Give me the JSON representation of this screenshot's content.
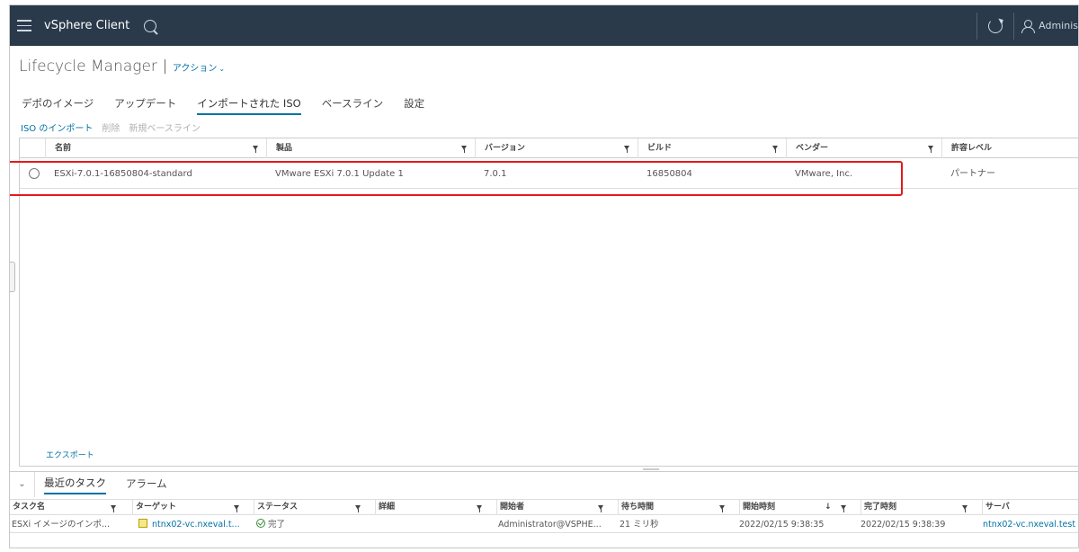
{
  "header": {
    "app_title": "vSphere Client",
    "user": "Adminis"
  },
  "page": {
    "title": "Lifecycle Manager",
    "actions_label": "アクション",
    "actions_chevron": "⌄"
  },
  "tabs": [
    {
      "label": "デポのイメージ"
    },
    {
      "label": "アップデート"
    },
    {
      "label": "インポートされた ISO",
      "active": true
    },
    {
      "label": "ベースライン"
    },
    {
      "label": "設定"
    }
  ],
  "toolbar": {
    "import_iso": "ISO のインポート",
    "delete": "削除",
    "new_baseline": "新規ベースライン"
  },
  "grid": {
    "columns": [
      "名前",
      "製品",
      "バージョン",
      "ビルド",
      "ベンダー",
      "許容レベル"
    ],
    "rows": [
      {
        "name": "ESXi-7.0.1-16850804-standard",
        "product": "VMware ESXi 7.0.1 Update 1",
        "version": "7.0.1",
        "build": "16850804",
        "vendor": "VMware, Inc.",
        "acceptance": "パートナー"
      }
    ],
    "export_label": "エクスポート"
  },
  "bottom": {
    "collapse": "⌄",
    "tabs": [
      {
        "label": "最近のタスク",
        "active": true
      },
      {
        "label": "アラーム"
      }
    ],
    "columns": [
      "タスク名",
      "ターゲット",
      "ステータス",
      "詳細",
      "開始者",
      "待ち時間",
      "開始時刻",
      "完了時刻",
      "サーバ"
    ],
    "sort_indicator": "↓",
    "rows": [
      {
        "task": "ESXi イメージのインポ...",
        "target": "ntnx02-vc.nxeval.t...",
        "status": "完了",
        "details": "",
        "initiator": "Administrator@VSPHE...",
        "queued": "21 ミリ秒",
        "start": "2022/02/15 9:38:35",
        "end": "2022/02/15 9:38:39",
        "server": "ntnx02-vc.nxeval.test"
      }
    ]
  },
  "colors": {
    "header_bg": "#2a3a4b",
    "link": "#0072a3",
    "highlight": "#e41a1a"
  }
}
